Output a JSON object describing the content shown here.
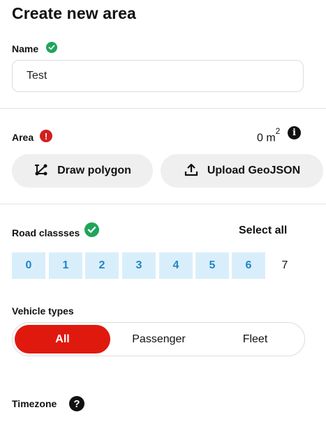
{
  "title": "Create new area",
  "name_section": {
    "label": "Name",
    "value": "Test",
    "status": "valid"
  },
  "area_section": {
    "label": "Area",
    "size_value": "0 m",
    "size_exponent": "2",
    "status": "error"
  },
  "actions": {
    "draw_label": "Draw polygon",
    "upload_label": "Upload GeoJSON"
  },
  "road_classes": {
    "label": "Road classses",
    "select_all_label": "Select all",
    "items": [
      "0",
      "1",
      "2",
      "3",
      "4",
      "5",
      "6",
      "7"
    ],
    "selected": [
      "0",
      "1",
      "2",
      "3",
      "4",
      "5",
      "6"
    ]
  },
  "vehicle_types": {
    "label": "Vehicle types",
    "options": [
      "All",
      "Passenger",
      "Fleet"
    ],
    "selected": "All"
  },
  "timezone": {
    "label": "Timezone"
  },
  "colors": {
    "accent": "#e0190f",
    "valid": "#1fa55a",
    "error": "#d21f1f",
    "chip_bg": "#d9eefb",
    "chip_text": "#1f86c6"
  },
  "icons": {
    "valid": "check-circle-icon",
    "error": "exclamation-icon",
    "info": "info-icon",
    "help": "question-icon",
    "draw": "polygon-draw-icon",
    "upload": "upload-icon"
  }
}
